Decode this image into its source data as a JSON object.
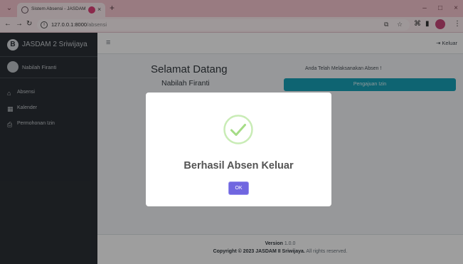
{
  "browser": {
    "tab_title": "Sistem Absensi - JASDAM I",
    "tab_close": "×",
    "new_tab": "+",
    "url_host": "127.0.0.1:8000",
    "url_path": "/absensi",
    "window_controls": [
      "–",
      "□",
      "×"
    ]
  },
  "sidebar": {
    "brand": "JASDAM 2 Sriwijaya",
    "brand_logo_letter": "B",
    "user_name": "Nabilah Firanti",
    "items": [
      {
        "label": "Absensi",
        "icon": "home-icon"
      },
      {
        "label": "Kalender",
        "icon": "calendar-icon"
      },
      {
        "label": "Permohonan Izin",
        "icon": "print-icon"
      }
    ]
  },
  "topnav": {
    "logout_label": "Keluar"
  },
  "content": {
    "welcome": "Selamat Datang",
    "user_name": "Nabilah Firanti",
    "status_text": "Anda Telah Melaksanakan Absen !",
    "izin_button": "Pengajuan Izin"
  },
  "footer": {
    "version_label": "Version",
    "version_value": "1.0.0",
    "copyright_prefix": "Copyright © 2023",
    "copyright_org": "JASDAM II Sriwijaya.",
    "copyright_suffix": "All rights reserved."
  },
  "modal": {
    "title": "Berhasil Absen Keluar",
    "ok_label": "OK",
    "icon": "success-check-icon"
  },
  "colors": {
    "tab_bar": "#f7c7d0",
    "sidebar": "#2b3036",
    "accent_info": "#17a2b8",
    "confirm_button": "#7066e0",
    "success": "#a5dc86"
  }
}
